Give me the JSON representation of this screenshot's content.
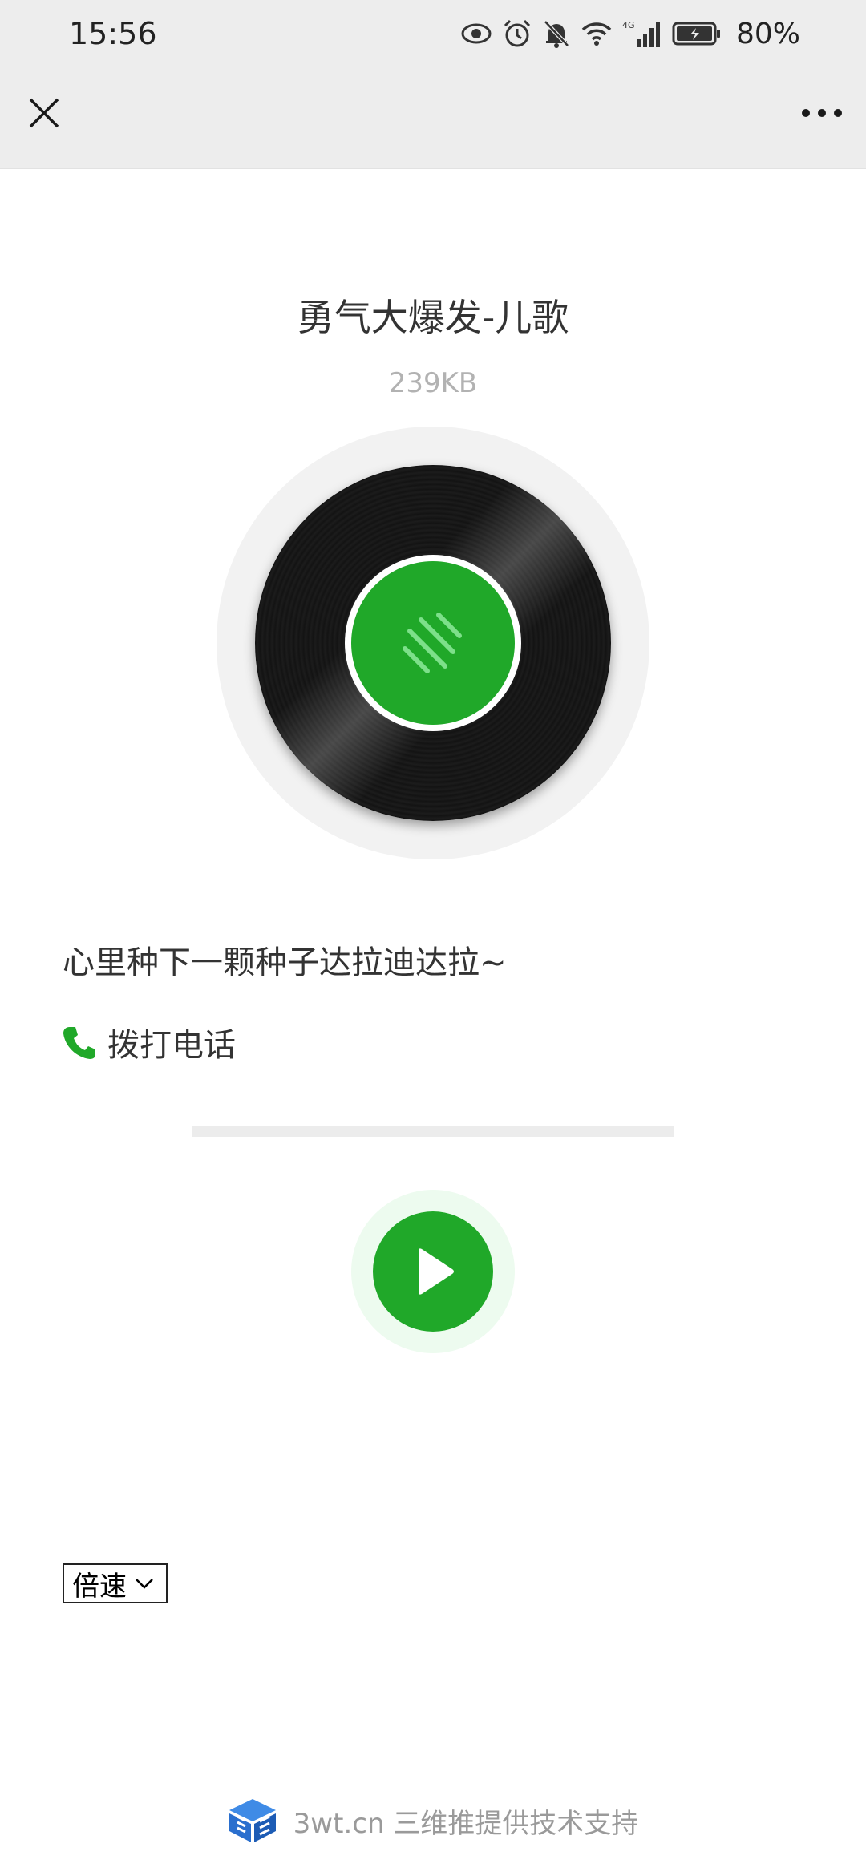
{
  "status_bar": {
    "time": "15:56",
    "battery_percent": "80%",
    "icons": [
      "eye-icon",
      "alarm-icon",
      "bell-off-icon",
      "wifi-icon",
      "cellular-4g-icon",
      "battery-icon"
    ]
  },
  "nav": {
    "close_icon": "close-icon",
    "more_icon": "more-icon"
  },
  "audio": {
    "title": "勇气大爆发-儿歌",
    "size": "239KB",
    "description": "心里种下一颗种子达拉迪达拉~",
    "progress": 0
  },
  "actions": {
    "call_label": "拨打电话"
  },
  "player": {
    "speed_label": "倍速"
  },
  "footer": {
    "text": "3wt.cn 三维推提供技术支持"
  },
  "colors": {
    "accent": "#20a829",
    "bar_bg": "#ededed",
    "muted_text": "#b2b2b2"
  }
}
